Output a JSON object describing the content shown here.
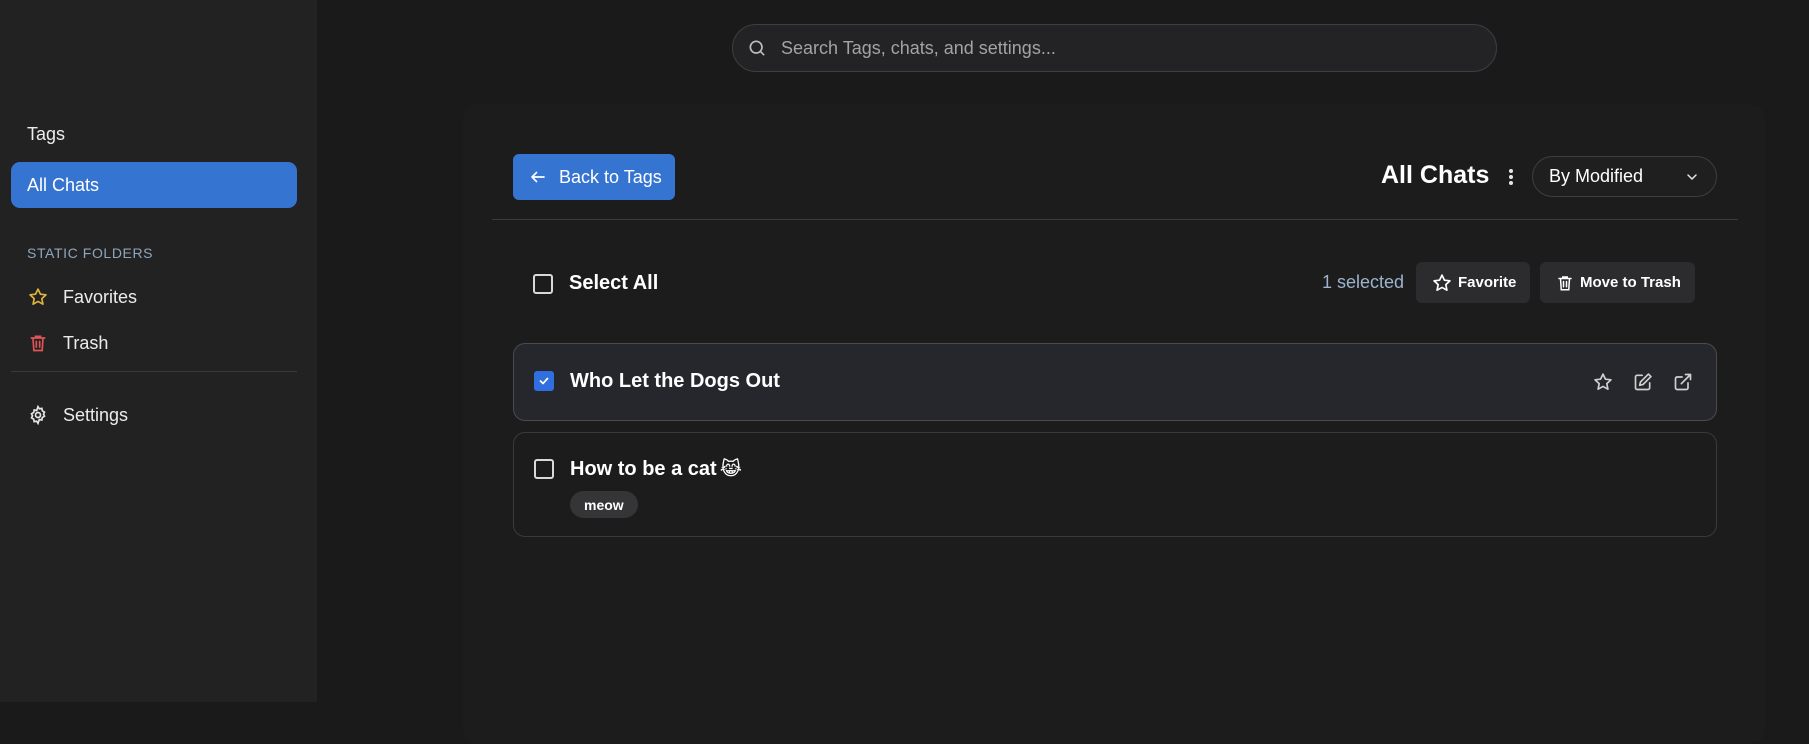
{
  "sidebar": {
    "tags_label": "Tags",
    "all_chats_label": "All Chats",
    "static_folders_heading": "STATIC FOLDERS",
    "favorites_label": "Favorites",
    "trash_label": "Trash",
    "settings_label": "Settings",
    "favorites_icon_color": "#e0b43a",
    "trash_icon_color": "#e05454"
  },
  "search": {
    "placeholder": "Search Tags, chats, and settings..."
  },
  "header": {
    "back_label": "Back to Tags",
    "title": "All Chats",
    "sort_value": "By Modified"
  },
  "toolbar": {
    "select_all_label": "Select All",
    "selected_count": "1 selected",
    "favorite_label": "Favorite",
    "move_to_trash_label": "Move to Trash"
  },
  "chats": [
    {
      "title": "Who Let the Dogs Out",
      "checked": true,
      "tags": []
    },
    {
      "title": "How to be a cat",
      "emoji": "😹",
      "checked": false,
      "tags": [
        "meow"
      ]
    }
  ],
  "colors": {
    "accent": "#3674d1",
    "checkbox_accent": "#2f6fe0",
    "background": "#1a1a1b",
    "sidebar": "#222223"
  }
}
